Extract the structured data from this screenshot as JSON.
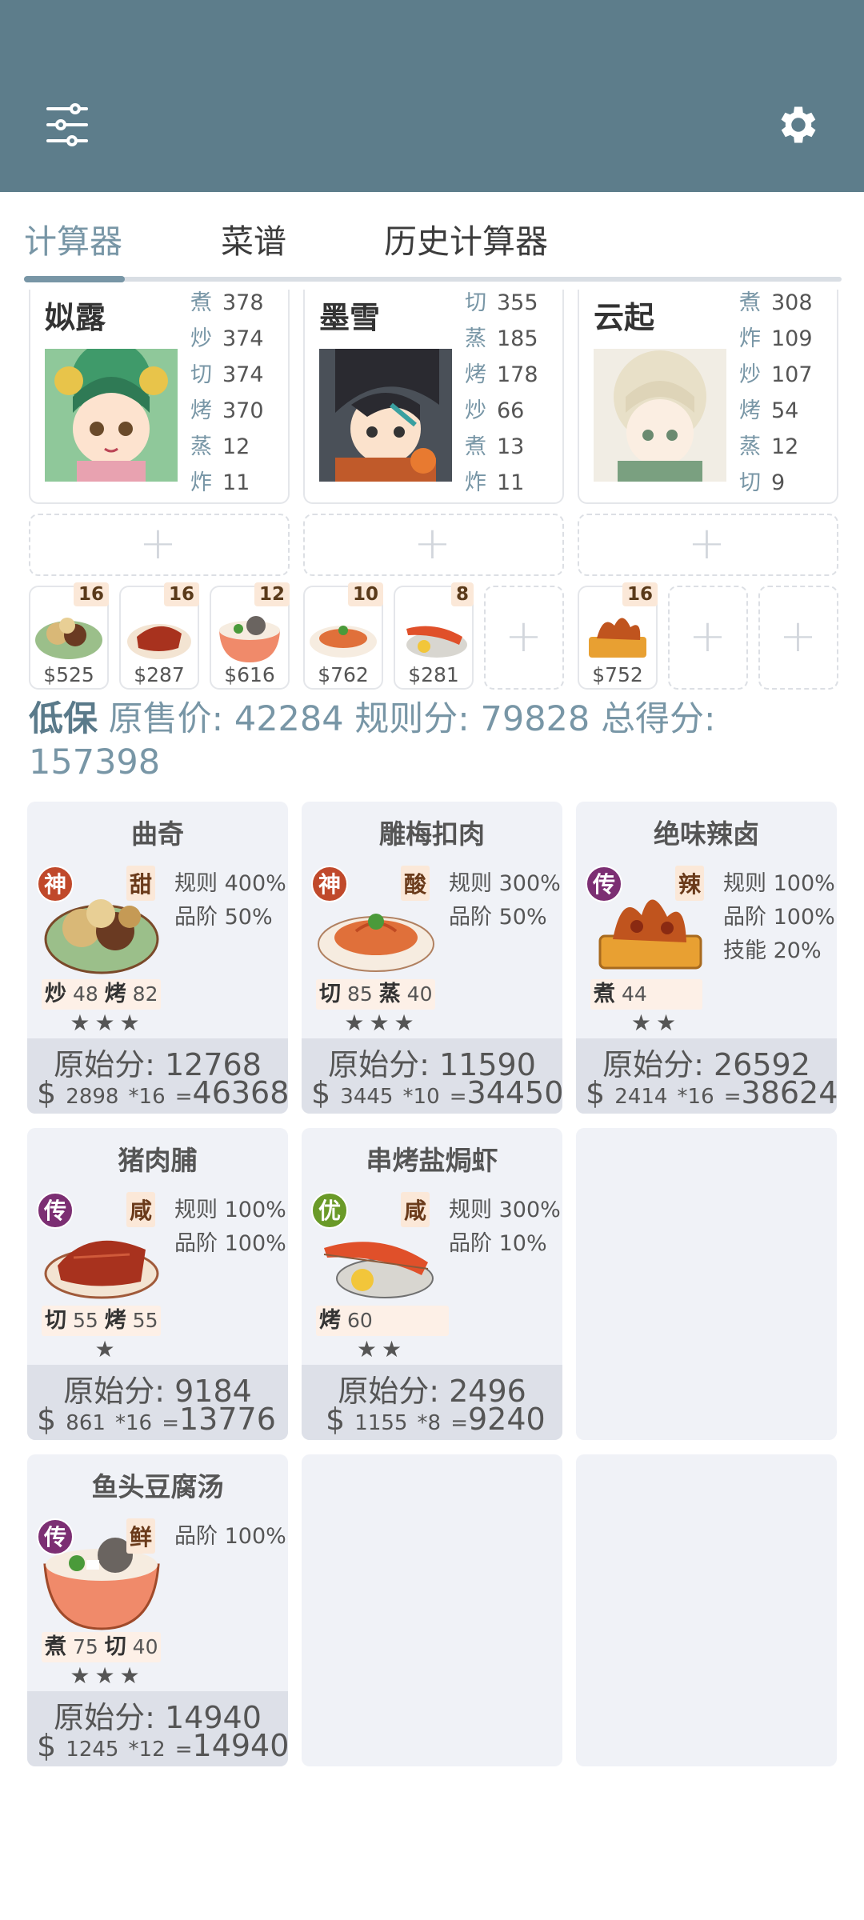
{
  "colors": {
    "header": "#5d7d8b",
    "accent": "#7896a6",
    "rarity_shen": "#c0492b",
    "rarity_chuan": "#7c2f73",
    "rarity_you": "#6a9a28"
  },
  "header": {
    "filter_icon": "sliders-icon",
    "settings_icon": "gear-icon"
  },
  "tabs": [
    {
      "label": "计算器"
    },
    {
      "label": "菜谱"
    },
    {
      "label": "历史计算器"
    }
  ],
  "chefs": [
    {
      "name": "姒露",
      "skills": [
        {
          "k": "煮",
          "v": "378"
        },
        {
          "k": "炒",
          "v": "374"
        },
        {
          "k": "切",
          "v": "374"
        },
        {
          "k": "烤",
          "v": "370"
        },
        {
          "k": "蒸",
          "v": "12"
        },
        {
          "k": "炸",
          "v": "11"
        }
      ]
    },
    {
      "name": "墨雪",
      "skills": [
        {
          "k": "切",
          "v": "355"
        },
        {
          "k": "蒸",
          "v": "185"
        },
        {
          "k": "烤",
          "v": "178"
        },
        {
          "k": "炒",
          "v": "66"
        },
        {
          "k": "煮",
          "v": "13"
        },
        {
          "k": "炸",
          "v": "11"
        }
      ]
    },
    {
      "name": "云起",
      "skills": [
        {
          "k": "煮",
          "v": "308"
        },
        {
          "k": "炸",
          "v": "109"
        },
        {
          "k": "炒",
          "v": "107"
        },
        {
          "k": "烤",
          "v": "54"
        },
        {
          "k": "蒸",
          "v": "12"
        },
        {
          "k": "切",
          "v": "9"
        }
      ]
    }
  ],
  "slots": [
    {
      "count": "16",
      "price": "$525"
    },
    {
      "count": "16",
      "price": "$287"
    },
    {
      "count": "12",
      "price": "$616"
    },
    {
      "count": "10",
      "price": "$762"
    },
    {
      "count": "8",
      "price": "$281"
    },
    {
      "count": "16",
      "price": "$752"
    }
  ],
  "summary": {
    "label": "低保",
    "text1": "原售价:",
    "price": "42284",
    "text2": "规则分:",
    "rule": "79828",
    "text3": "总得分:",
    "total": "157398"
  },
  "dishes": [
    {
      "title": "曲奇",
      "rarity": "神",
      "flavor": "甜",
      "effects": [
        "规则 400%",
        "品阶 50%"
      ],
      "req": [
        {
          "k": "炒",
          "v": "48"
        },
        {
          "k": "烤",
          "v": "82"
        }
      ],
      "stars": "★★★",
      "raw": "原始分: 12768",
      "dollar": "$",
      "unit": "2898",
      "mult": "*16",
      "eq": "=",
      "result": "46368"
    },
    {
      "title": "雕梅扣肉",
      "rarity": "神",
      "flavor": "酸",
      "effects": [
        "规则 300%",
        "品阶 50%"
      ],
      "req": [
        {
          "k": "切",
          "v": "85"
        },
        {
          "k": "蒸",
          "v": "40"
        }
      ],
      "stars": "★★★",
      "raw": "原始分: 11590",
      "dollar": "$",
      "unit": "3445",
      "mult": "*10",
      "eq": "=",
      "result": "34450"
    },
    {
      "title": "绝味辣卤",
      "rarity": "传",
      "flavor": "辣",
      "effects": [
        "规则 100%",
        "品阶 100%",
        "技能 20%"
      ],
      "req": [
        {
          "k": "煮",
          "v": "44"
        }
      ],
      "stars": "★★",
      "raw": "原始分: 26592",
      "dollar": "$",
      "unit": "2414",
      "mult": "*16",
      "eq": "=",
      "result": "38624"
    },
    {
      "title": "猪肉脯",
      "rarity": "传",
      "flavor": "咸",
      "effects": [
        "规则 100%",
        "品阶 100%"
      ],
      "req": [
        {
          "k": "切",
          "v": "55"
        },
        {
          "k": "烤",
          "v": "55"
        }
      ],
      "stars": "★",
      "raw": "原始分: 9184",
      "dollar": "$",
      "unit": "861",
      "mult": "*16",
      "eq": "=",
      "result": "13776"
    },
    {
      "title": "串烤盐焗虾",
      "rarity": "优",
      "flavor": "咸",
      "effects": [
        "规则 300%",
        "品阶 10%"
      ],
      "req": [
        {
          "k": "烤",
          "v": "60"
        }
      ],
      "stars": "★★",
      "raw": "原始分: 2496",
      "dollar": "$",
      "unit": "1155",
      "mult": "*8",
      "eq": "=",
      "result": "9240"
    },
    {
      "title": "鱼头豆腐汤",
      "rarity": "传",
      "flavor": "鲜",
      "effects": [
        "品阶 100%"
      ],
      "req": [
        {
          "k": "煮",
          "v": "75"
        },
        {
          "k": "切",
          "v": "40"
        }
      ],
      "stars": "★★★",
      "raw": "原始分: 14940",
      "dollar": "$",
      "unit": "1245",
      "mult": "*12",
      "eq": "=",
      "result": "14940"
    }
  ]
}
